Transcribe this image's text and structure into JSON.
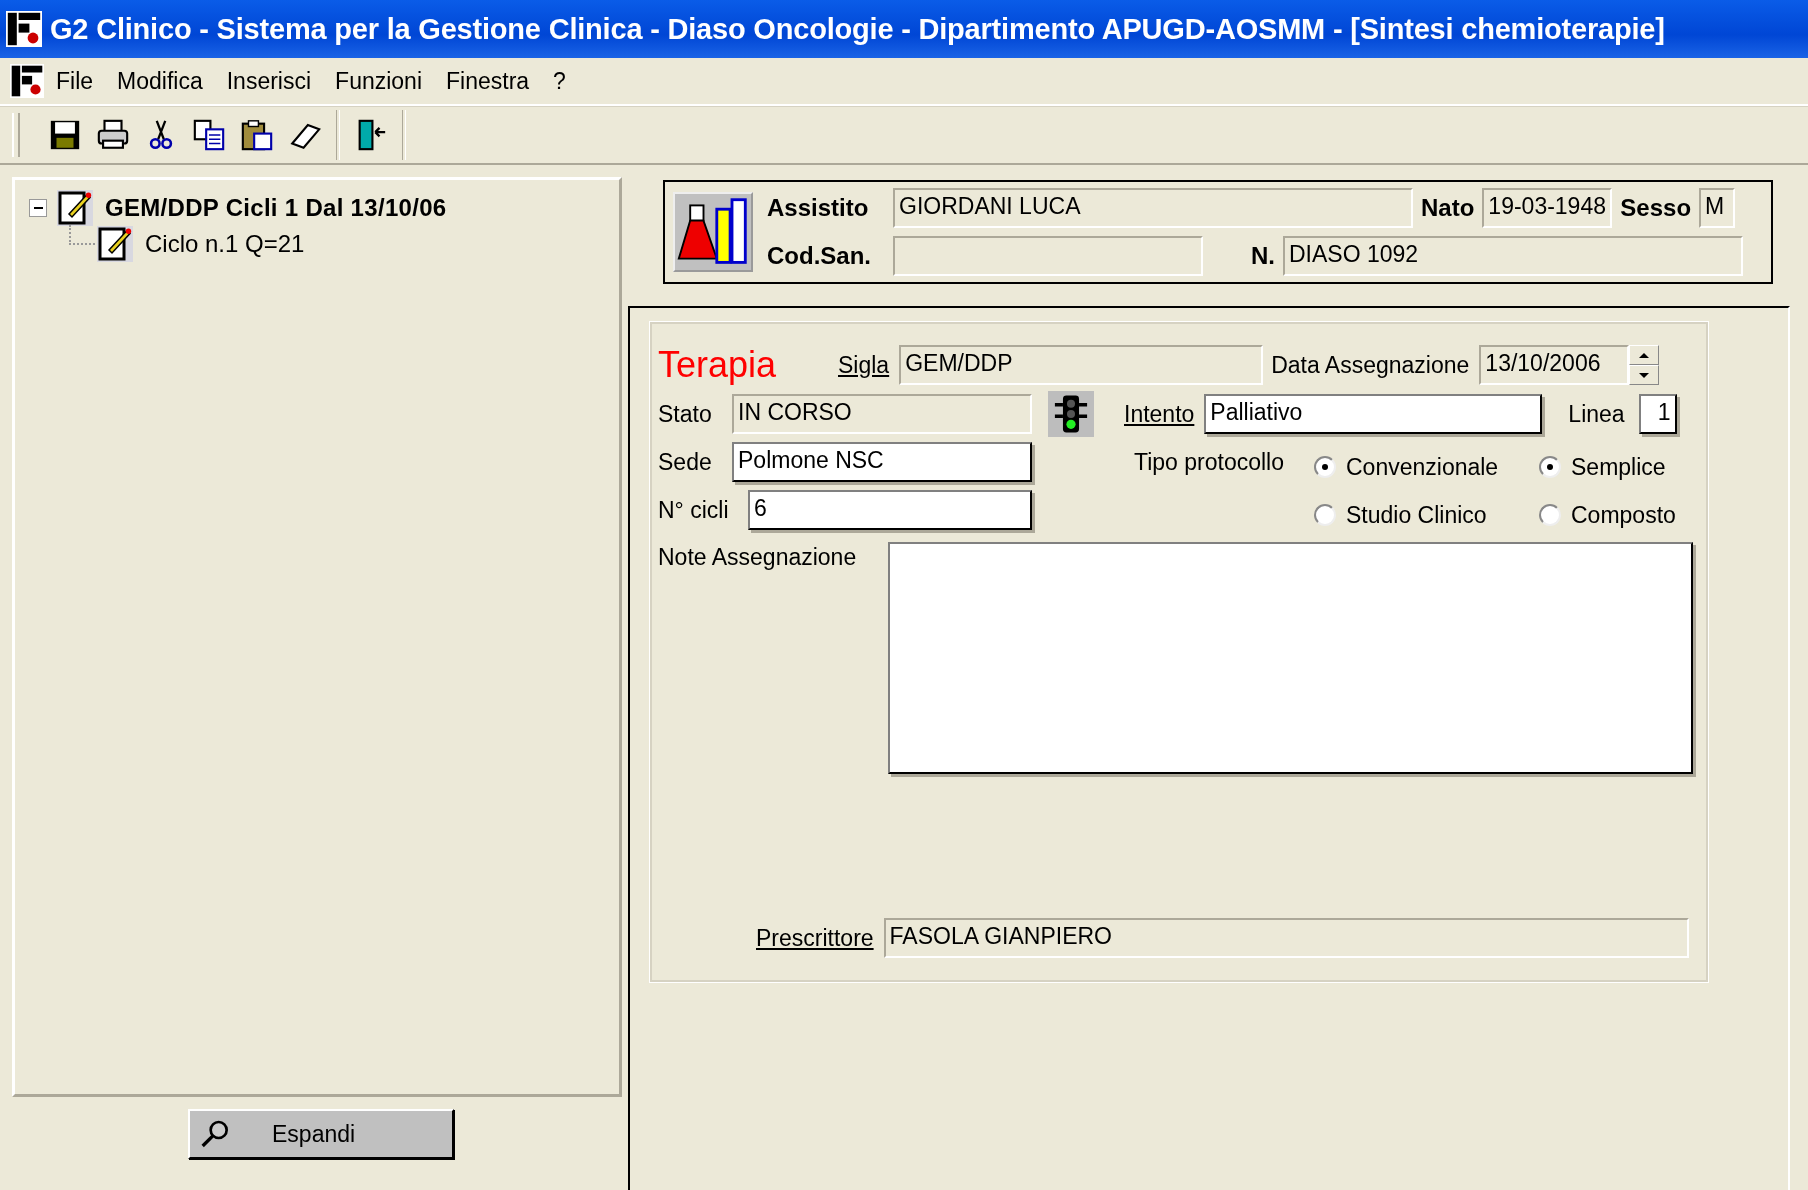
{
  "window": {
    "title": "G2 Clinico - Sistema per la Gestione Clinica - Diaso Oncologie - Dipartimento APUGD-AOSMM - [Sintesi chemioterapie]"
  },
  "menu": [
    "File",
    "Modifica",
    "Inserisci",
    "Funzioni",
    "Finestra",
    "?"
  ],
  "tree": [
    {
      "label": "GEM/DDP Cicli 1 Dal 13/10/06",
      "expanded": true,
      "children": [
        {
          "label": "Ciclo n.1 Q=21"
        }
      ]
    }
  ],
  "expand_button": "Espandi",
  "patient": {
    "assistito": {
      "label": "Assistito",
      "value": "GIORDANI LUCA"
    },
    "nato": {
      "label": "Nato",
      "value": "19-03-1948"
    },
    "sesso": {
      "label": "Sesso",
      "value": "M"
    },
    "cod_san": {
      "label": "Cod.San."
    },
    "numero": {
      "label": "N.",
      "value": "DIASO 1092"
    }
  },
  "therapy": {
    "title": "Terapia",
    "sigla": {
      "label": "Sigla",
      "value": "GEM/DDP",
      "disabled": true
    },
    "data_assegnazione": {
      "label": "Data Assegnazione",
      "value": "13/10/2006",
      "disabled": true
    },
    "stato": {
      "label": "Stato",
      "value": "IN CORSO",
      "disabled": true
    },
    "intento": {
      "label": "Intento",
      "value": "Palliativo",
      "disabled": false
    },
    "linea": {
      "label": "Linea",
      "value": "1",
      "disabled": false
    },
    "sede": {
      "label": "Sede",
      "value": "Polmone NSC",
      "disabled": false
    },
    "cicli": {
      "label": "N° cicli",
      "value": "6",
      "disabled": false
    },
    "tipo_label": "Tipo protocollo",
    "protocol_type": [
      {
        "label": "Convenzionale",
        "selected": true
      },
      {
        "label": "Studio Clinico",
        "selected": false
      }
    ],
    "complexity": [
      {
        "label": "Semplice",
        "selected": true
      },
      {
        "label": "Composto",
        "selected": false
      }
    ],
    "note": {
      "label": "Note Assegnazione",
      "disabled": false
    },
    "prescrittore": {
      "label": "Prescrittore",
      "value": "FASOLA GIANPIERO",
      "disabled": true
    }
  }
}
